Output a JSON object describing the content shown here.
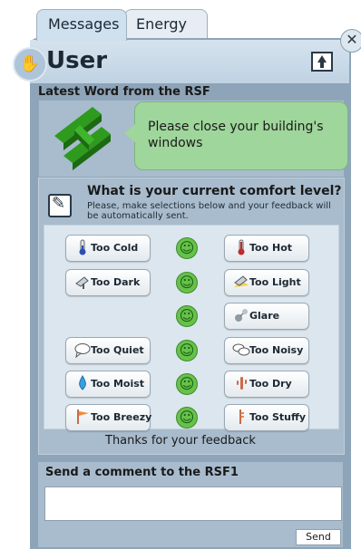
{
  "tabs": [
    {
      "label": "Messages"
    },
    {
      "label": "Energy"
    }
  ],
  "header": {
    "title": "User"
  },
  "latest": {
    "title": "Latest Word from the RSF",
    "message": "Please close your building's windows"
  },
  "comfort": {
    "title": "What is your current comfort level?",
    "subtitle": "Please, make selections below and your feedback will be automatically sent.",
    "buttons": [
      {
        "label": "Too Cold"
      },
      {
        "label": "Too Hot"
      },
      {
        "label": "Too Dark"
      },
      {
        "label": "Too Light"
      },
      {
        "label": "Glare"
      },
      {
        "label": "Too Quiet"
      },
      {
        "label": "Too Noisy"
      },
      {
        "label": "Too Moist"
      },
      {
        "label": "Too Dry"
      },
      {
        "label": "Too Breezy"
      },
      {
        "label": "Too Stuffy"
      }
    ],
    "thanks": "Thanks for your feedback"
  },
  "comment": {
    "title": "Send a comment to the RSF1",
    "value": "",
    "send_label": "Send"
  },
  "colors": {
    "accent_green": "#66c24a",
    "bubble_green": "#9fd69b",
    "panel": "#8ea4b8"
  }
}
